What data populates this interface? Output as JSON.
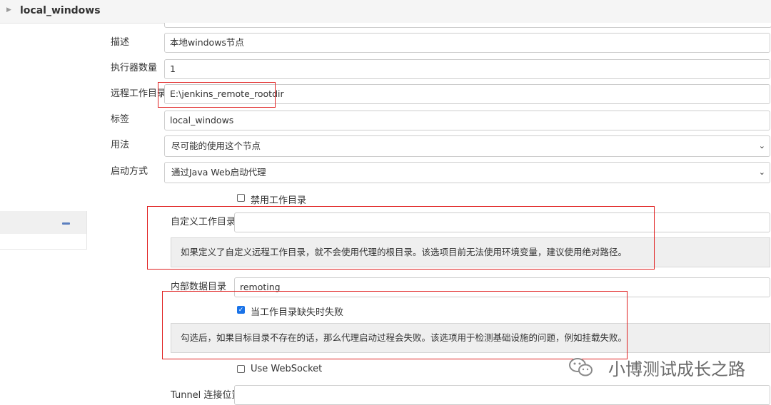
{
  "header": {
    "node_name": "local_windows"
  },
  "form": {
    "description": {
      "label": "描述",
      "value": "本地windows节点"
    },
    "executors": {
      "label": "执行器数量",
      "value": "1"
    },
    "remote_root": {
      "label": "远程工作目录",
      "value": "E:\\jenkins_remote_rootdir"
    },
    "labels": {
      "label": "标签",
      "value": "local_windows"
    },
    "usage": {
      "label": "用法",
      "selected": "尽可能的使用这个节点"
    },
    "launch_method": {
      "label": "启动方式",
      "selected": "通过Java Web启动代理"
    },
    "disable_workdir": {
      "label": "禁用工作目录",
      "checked": false
    },
    "custom_workdir": {
      "label": "自定义工作目录",
      "value": "",
      "help": "如果定义了自定义远程工作目录，就不会使用代理的根目录。该选项目前无法使用环境变量，建议使用绝对路径。"
    },
    "internal_data_dir": {
      "label": "内部数据目录",
      "value": "remoting"
    },
    "fail_if_missing": {
      "label": "当工作目录缺失时失败",
      "checked": true,
      "help": "勾选后，如果目标目录不存在的话，那么代理启动过程会失败。该选项用于检测基础设施的问题，例如挂载失败。"
    },
    "use_websocket": {
      "label": "Use WebSocket",
      "checked": false
    },
    "tunnel": {
      "label": "Tunnel 连接位置",
      "value": ""
    }
  },
  "watermark": {
    "text": "小博测试成长之路",
    "icon": "wechat-icon"
  },
  "colors": {
    "highlight": "#e02020",
    "help_bg": "#efefef",
    "checkbox": "#1a73e8"
  }
}
